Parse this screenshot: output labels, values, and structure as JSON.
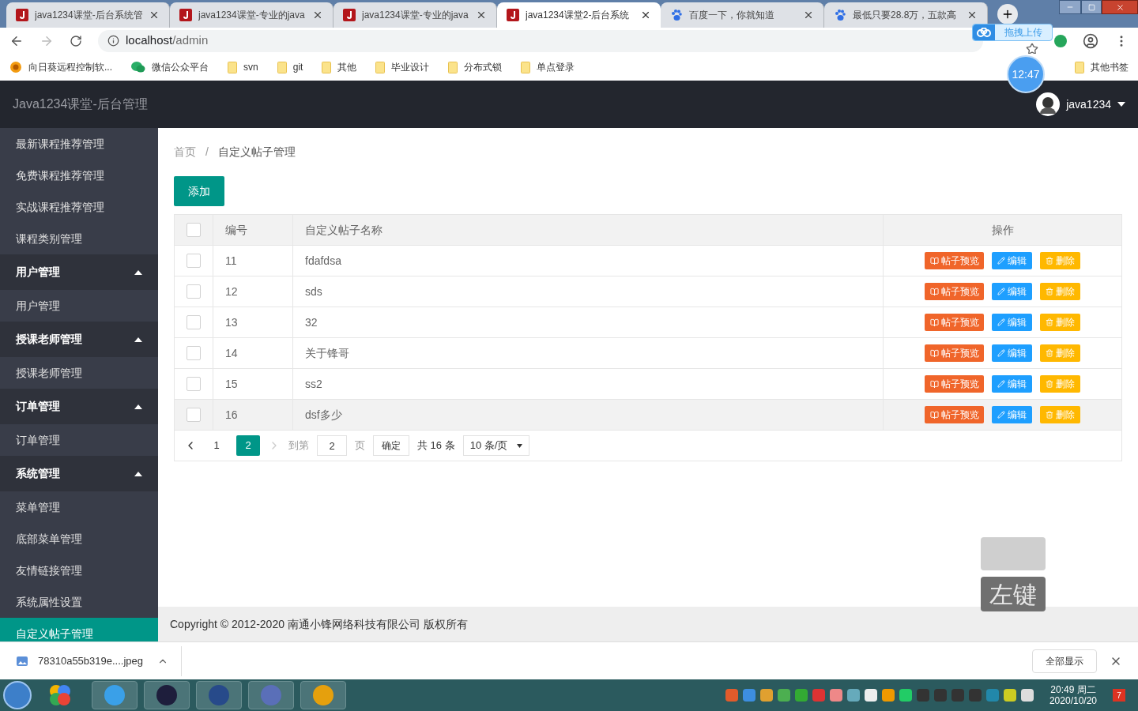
{
  "browser": {
    "tabs": [
      {
        "title": "java1234课堂-后台系统管",
        "kind": "java",
        "selected": false
      },
      {
        "title": "java1234课堂-专业的java",
        "kind": "java",
        "selected": false
      },
      {
        "title": "java1234课堂-专业的java",
        "kind": "java",
        "selected": false
      },
      {
        "title": "java1234课堂2-后台系统",
        "kind": "java",
        "selected": true
      },
      {
        "title": "百度一下，你就知道",
        "kind": "baidu",
        "selected": false
      },
      {
        "title": "最低只要28.8万，五款高",
        "kind": "baidu",
        "selected": false
      }
    ],
    "address": {
      "host": "localhost",
      "path": "/admin"
    },
    "bookmarks": [
      {
        "label": "向日葵远程控制软...",
        "kind": "sunflower"
      },
      {
        "label": "微信公众平台",
        "kind": "wechat"
      },
      {
        "label": "svn",
        "kind": "folder"
      },
      {
        "label": "git",
        "kind": "folder"
      },
      {
        "label": "其他",
        "kind": "folder"
      },
      {
        "label": "毕业设计",
        "kind": "folder"
      },
      {
        "label": "分布式锁",
        "kind": "folder"
      },
      {
        "label": "单点登录",
        "kind": "folder"
      }
    ],
    "other_bookmarks": "其他书签",
    "upload_pill": "拖拽上传",
    "clock_bubble": "12:47"
  },
  "app": {
    "title": "Java1234课堂-后台管理",
    "user": "java1234"
  },
  "sidebar": {
    "items": [
      {
        "kind": "link",
        "label": "最新课程推荐管理",
        "selected": false
      },
      {
        "kind": "link",
        "label": "免费课程推荐管理",
        "selected": false
      },
      {
        "kind": "link",
        "label": "实战课程推荐管理",
        "selected": false
      },
      {
        "kind": "link",
        "label": "课程类别管理",
        "selected": false
      },
      {
        "kind": "group",
        "label": "用户管理",
        "expanded": true,
        "children": [
          {
            "label": "用户管理",
            "selected": false
          }
        ]
      },
      {
        "kind": "group",
        "label": "授课老师管理",
        "expanded": true,
        "children": [
          {
            "label": "授课老师管理",
            "selected": false
          }
        ]
      },
      {
        "kind": "group",
        "label": "订单管理",
        "expanded": true,
        "children": [
          {
            "label": "订单管理",
            "selected": false
          }
        ]
      },
      {
        "kind": "group",
        "label": "系统管理",
        "expanded": true,
        "children": [
          {
            "label": "菜单管理",
            "selected": false
          },
          {
            "label": "底部菜单管理",
            "selected": false
          },
          {
            "label": "友情链接管理",
            "selected": false
          },
          {
            "label": "系统属性设置",
            "selected": false
          },
          {
            "label": "自定义帖子管理",
            "selected": true
          }
        ]
      }
    ]
  },
  "breadcrumb": {
    "items": [
      "首页",
      "自定义帖子管理"
    ],
    "separator": "/"
  },
  "add_button": "添加",
  "table": {
    "columns": [
      "编号",
      "自定义帖子名称",
      "操作"
    ],
    "header_checked": false,
    "rows": [
      {
        "id": "11",
        "name": "fdafdsa",
        "checked": false,
        "hovered": false,
        "actions": [
          {
            "kind": "preview",
            "label": "帖子预览"
          },
          {
            "kind": "edit",
            "label": "编辑"
          },
          {
            "kind": "delete",
            "label": "删除"
          }
        ]
      },
      {
        "id": "12",
        "name": "sds",
        "checked": false,
        "hovered": false,
        "actions": [
          {
            "kind": "preview",
            "label": "帖子预览"
          },
          {
            "kind": "edit",
            "label": "编辑"
          },
          {
            "kind": "delete",
            "label": "删除"
          }
        ]
      },
      {
        "id": "13",
        "name": "32",
        "checked": false,
        "hovered": false,
        "actions": [
          {
            "kind": "preview",
            "label": "帖子预览"
          },
          {
            "kind": "edit",
            "label": "编辑"
          },
          {
            "kind": "delete",
            "label": "删除"
          }
        ]
      },
      {
        "id": "14",
        "name": "关于锋哥",
        "checked": false,
        "hovered": false,
        "actions": [
          {
            "kind": "preview",
            "label": "帖子预览"
          },
          {
            "kind": "edit",
            "label": "编辑"
          },
          {
            "kind": "delete",
            "label": "删除"
          }
        ]
      },
      {
        "id": "15",
        "name": "ss2",
        "checked": false,
        "hovered": false,
        "actions": [
          {
            "kind": "preview",
            "label": "帖子预览"
          },
          {
            "kind": "edit",
            "label": "编辑"
          },
          {
            "kind": "delete",
            "label": "删除"
          }
        ]
      },
      {
        "id": "16",
        "name": "dsf多少",
        "checked": false,
        "hovered": true,
        "actions": [
          {
            "kind": "preview",
            "label": "帖子预览"
          },
          {
            "kind": "edit",
            "label": "编辑"
          },
          {
            "kind": "delete",
            "label": "删除"
          }
        ]
      }
    ]
  },
  "pagination": {
    "pages": [
      {
        "label": "1",
        "selected": false
      },
      {
        "label": "2",
        "selected": true
      }
    ],
    "goto_label": "到第",
    "goto_value": "2",
    "page_unit": "页",
    "confirm": "确定",
    "total": "共 16 条",
    "page_size": "10 条/页"
  },
  "footer": "Copyright © 2012-2020 南通小锋网络科技有限公司 版权所有",
  "key_overlay": "左键",
  "download_bar": {
    "file": "78310a55b319e....jpeg",
    "show_all": "全部显示"
  },
  "taskbar": {
    "time": "20:49 周二",
    "date": "2020/10/20",
    "notifications": "7"
  }
}
